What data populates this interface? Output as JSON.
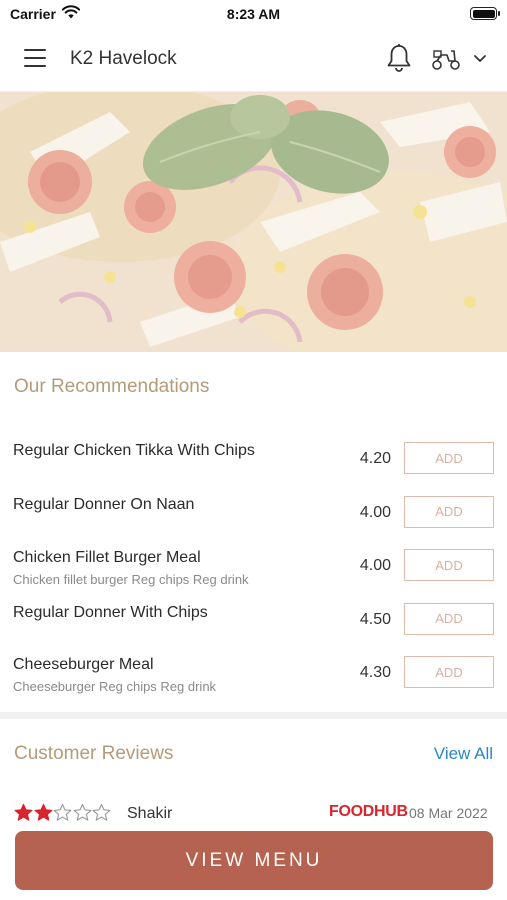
{
  "status_bar": {
    "carrier": "Carrier",
    "time": "8:23 AM"
  },
  "header": {
    "store_name": "K2 Havelock",
    "icons": [
      "menu-icon",
      "bell-icon",
      "scooter-icon",
      "chevron-down-icon"
    ]
  },
  "hero": {
    "image": "pizza-photo"
  },
  "recommendations": {
    "title": "Our Recommendations",
    "items": [
      {
        "name": "Regular Chicken Tikka With Chips",
        "description": "",
        "price": "4.20",
        "add_label": "ADD"
      },
      {
        "name": "Regular Donner On Naan",
        "description": "",
        "price": "4.00",
        "add_label": "ADD"
      },
      {
        "name": "Chicken Fillet Burger Meal",
        "description": "Chicken fillet burger Reg chips Reg drink",
        "price": "4.00",
        "add_label": "ADD"
      },
      {
        "name": "Regular Donner With Chips",
        "description": "",
        "price": "4.50",
        "add_label": "ADD"
      },
      {
        "name": "Cheeseburger Meal",
        "description": "Cheeseburger Reg chips Reg drink",
        "price": "4.30",
        "add_label": "ADD"
      }
    ]
  },
  "reviews": {
    "title": "Customer Reviews",
    "view_all_label": "View All",
    "items": [
      {
        "rating": 2,
        "max_rating": 5,
        "reviewer": "Shakir",
        "source": "FOODHUB",
        "date": "08 Mar 2022"
      }
    ]
  },
  "footer": {
    "view_menu_label": "VIEW MENU"
  },
  "colors": {
    "accent": "#b56350",
    "section_title": "#b59b78",
    "link": "#2a87c6",
    "add_border": "#e2b9ad",
    "star_filled": "#d9232d",
    "brand_logo": "#d9232d"
  }
}
